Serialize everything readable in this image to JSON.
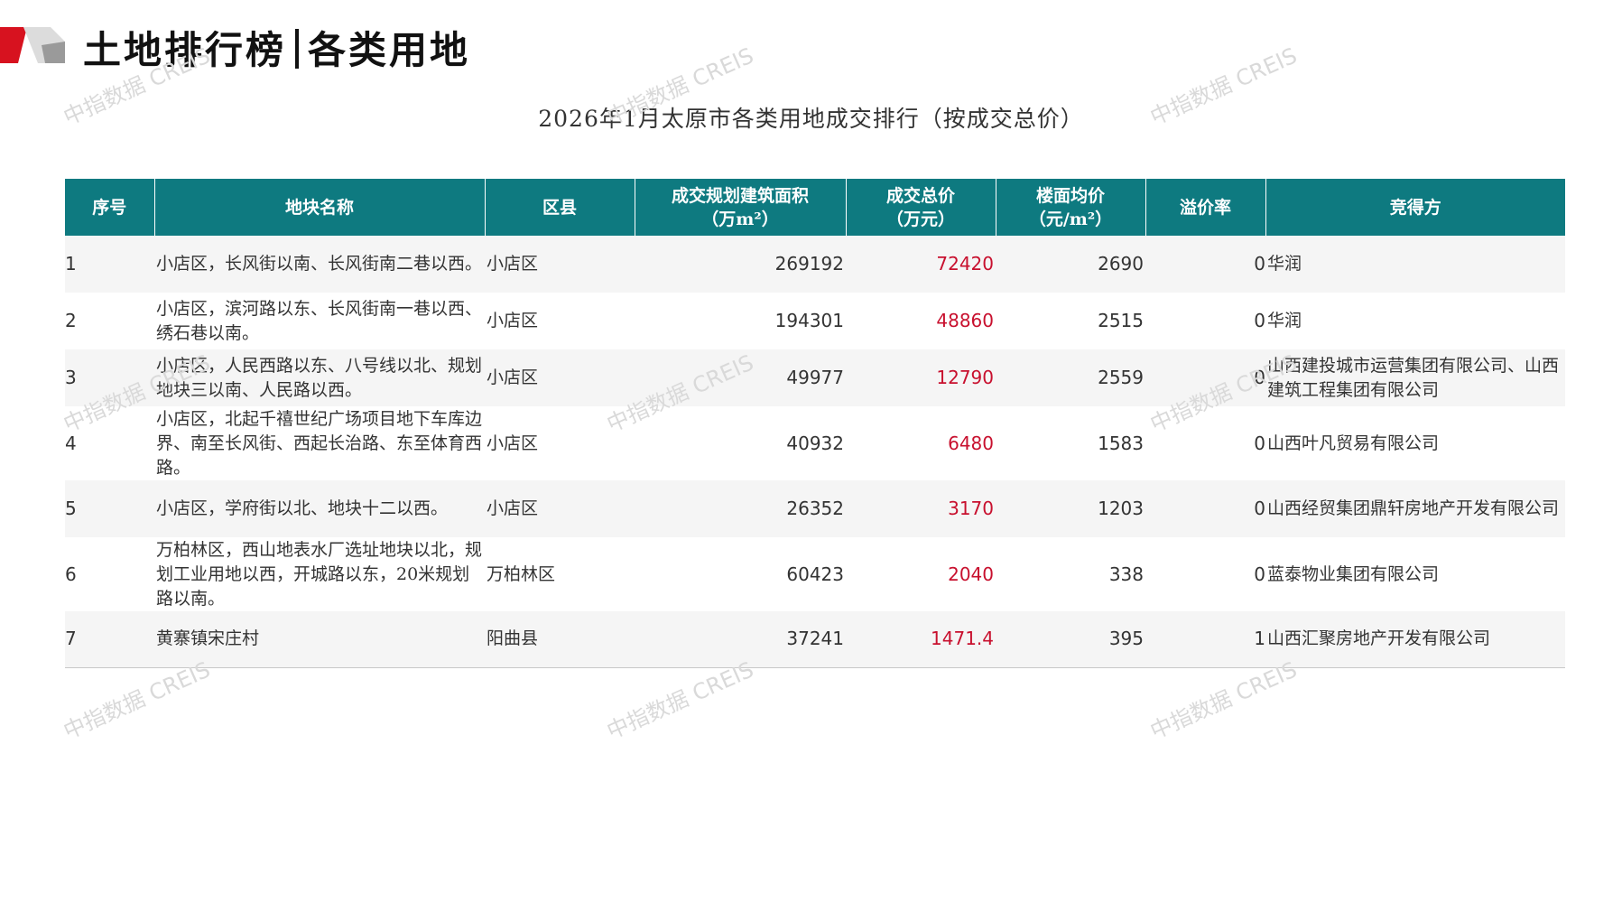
{
  "header": {
    "title_part1": "土地排行榜",
    "title_part2": "各类用地"
  },
  "table_title": "2026年1月太原市各类用地成交排行（按成交总价）",
  "table": {
    "headers": {
      "index": "序号",
      "name": "地块名称",
      "district": "区县",
      "area_line1": "成交规划建筑面积",
      "area_line2": "（万m²）",
      "price_line1": "成交总价",
      "price_line2": "（万元）",
      "unit_line1": "楼面均价",
      "unit_line2": "（元/m²）",
      "premium": "溢价率",
      "winner": "竞得方"
    },
    "rows": [
      {
        "index": "1",
        "name": "小店区，长风街以南、长风街南二巷以西。",
        "district": "小店区",
        "area": "269192",
        "price": "72420",
        "unit_price": "2690",
        "premium": "0",
        "winner": "华润"
      },
      {
        "index": "2",
        "name": "小店区，滨河路以东、长风街南一巷以西、绣石巷以南。",
        "district": "小店区",
        "area": "194301",
        "price": "48860",
        "unit_price": "2515",
        "premium": "0",
        "winner": "华润"
      },
      {
        "index": "3",
        "name": "小店区，人民西路以东、八号线以北、规划地块三以南、人民路以西。",
        "district": "小店区",
        "area": "49977",
        "price": "12790",
        "unit_price": "2559",
        "premium": "0",
        "winner": "山西建投城市运营集团有限公司、山西建筑工程集团有限公司"
      },
      {
        "index": "4",
        "name": "小店区，北起千禧世纪广场项目地下车库边界、南至长风街、西起长治路、东至体育西路。",
        "district": "小店区",
        "area": "40932",
        "price": "6480",
        "unit_price": "1583",
        "premium": "0",
        "winner": "山西叶凡贸易有限公司"
      },
      {
        "index": "5",
        "name": "小店区，学府街以北、地块十二以西。",
        "district": "小店区",
        "area": "26352",
        "price": "3170",
        "unit_price": "1203",
        "premium": "0",
        "winner": "山西经贸集团鼎轩房地产开发有限公司"
      },
      {
        "index": "6",
        "name": "万柏林区，西山地表水厂选址地块以北，规划工业用地以西，开城路以东，20米规划路以南。",
        "district": "万柏林区",
        "area": "60423",
        "price": "2040",
        "unit_price": "338",
        "premium": "0",
        "winner": "蓝泰物业集团有限公司"
      },
      {
        "index": "7",
        "name": "黄寨镇宋庄村",
        "district": "阳曲县",
        "area": "37241",
        "price": "1471.4",
        "unit_price": "395",
        "premium": "1",
        "winner": "山西汇聚房地产开发有限公司"
      }
    ]
  },
  "watermark": "中指数据 CREIS",
  "colors": {
    "header_bg": "#0e7a80",
    "price_text": "#c8102e",
    "logo_red": "#d7121f",
    "logo_gray": "#9a9a9a"
  }
}
